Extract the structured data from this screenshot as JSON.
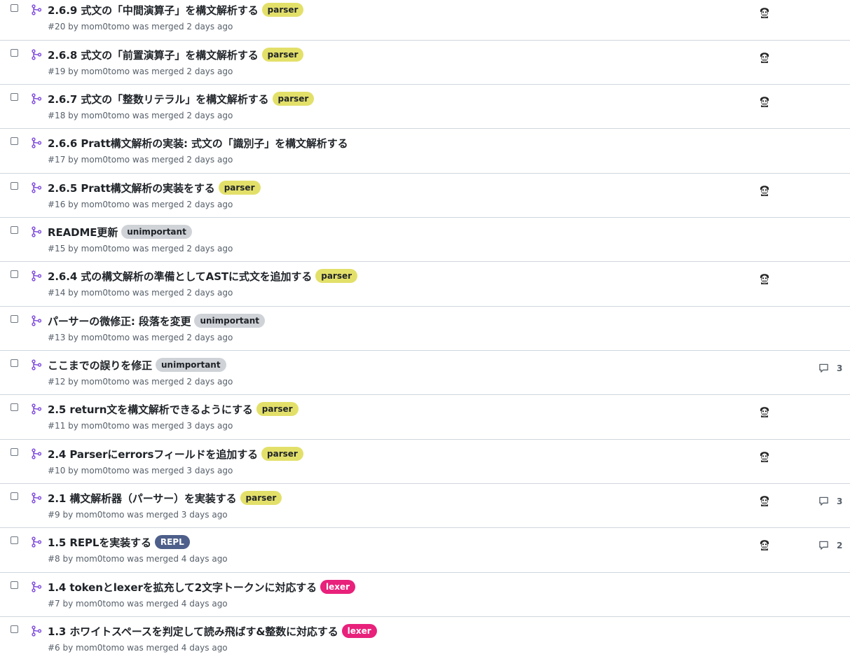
{
  "colors": {
    "parser": {
      "bg": "#e3e06a",
      "fg": "#1f2328"
    },
    "unimportant": {
      "bg": "#cfd3d8",
      "fg": "#1f2328"
    },
    "REPL": {
      "bg": "#4d5f8a",
      "fg": "#ffffff"
    },
    "lexer": {
      "bg": "#e8217b",
      "fg": "#ffffff"
    },
    "merged_icon": "#8250df"
  },
  "pull_requests": [
    {
      "title": "2.6.9 式文の「中間演算子」を構文解析する",
      "label": "parser",
      "meta": "#20 by mom0tomo was merged 2 days ago",
      "avatar": true,
      "comments": ""
    },
    {
      "title": "2.6.8 式文の「前置演算子」を構文解析する",
      "label": "parser",
      "meta": "#19 by mom0tomo was merged 2 days ago",
      "avatar": true,
      "comments": ""
    },
    {
      "title": "2.6.7 式文の「整数リテラル」を構文解析する",
      "label": "parser",
      "meta": "#18 by mom0tomo was merged 2 days ago",
      "avatar": true,
      "comments": ""
    },
    {
      "title": "2.6.6 Pratt構文解析の実装: 式文の「識別子」を構文解析する",
      "label": "",
      "meta": "#17 by mom0tomo was merged 2 days ago",
      "avatar": false,
      "comments": ""
    },
    {
      "title": "2.6.5 Pratt構文解析の実装をする",
      "label": "parser",
      "meta": "#16 by mom0tomo was merged 2 days ago",
      "avatar": true,
      "comments": ""
    },
    {
      "title": "README更新",
      "label": "unimportant",
      "meta": "#15 by mom0tomo was merged 2 days ago",
      "avatar": false,
      "comments": ""
    },
    {
      "title": "2.6.4 式の構文解析の準備としてASTに式文を追加する",
      "label": "parser",
      "meta": "#14 by mom0tomo was merged 2 days ago",
      "avatar": true,
      "comments": ""
    },
    {
      "title": "パーサーの微修正: 段落を変更",
      "label": "unimportant",
      "meta": "#13 by mom0tomo was merged 2 days ago",
      "avatar": false,
      "comments": ""
    },
    {
      "title": "ここまでの誤りを修正",
      "label": "unimportant",
      "meta": "#12 by mom0tomo was merged 2 days ago",
      "avatar": false,
      "comments": "3"
    },
    {
      "title": "2.5 return文を構文解析できるようにする",
      "label": "parser",
      "meta": "#11 by mom0tomo was merged 3 days ago",
      "avatar": true,
      "comments": ""
    },
    {
      "title": "2.4 Parserにerrorsフィールドを追加する",
      "label": "parser",
      "meta": "#10 by mom0tomo was merged 3 days ago",
      "avatar": true,
      "comments": ""
    },
    {
      "title": "2.1 構文解析器（パーサー）を実装する",
      "label": "parser",
      "meta": "#9 by mom0tomo was merged 3 days ago",
      "avatar": true,
      "comments": "3"
    },
    {
      "title": "1.5 REPLを実装する",
      "label": "REPL",
      "meta": "#8 by mom0tomo was merged 4 days ago",
      "avatar": true,
      "comments": "2"
    },
    {
      "title": "1.4 tokenとlexerを拡充して2文字トークンに対応する",
      "label": "lexer",
      "meta": "#7 by mom0tomo was merged 4 days ago",
      "avatar": false,
      "comments": ""
    },
    {
      "title": "1.3 ホワイトスペースを判定して読み飛ばす&整数に対応する",
      "label": "lexer",
      "meta": "#6 by mom0tomo was merged 4 days ago",
      "avatar": false,
      "comments": ""
    }
  ]
}
